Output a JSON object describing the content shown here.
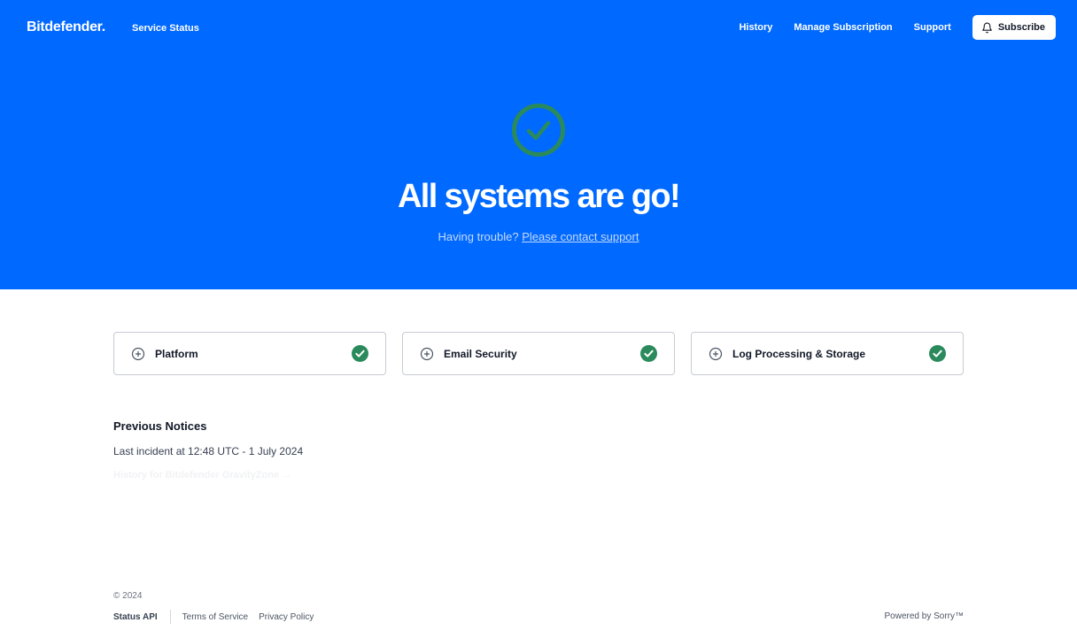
{
  "header": {
    "logo": "Bitdefender.",
    "service_status": "Service Status",
    "nav": {
      "history": "History",
      "manage_subscription": "Manage Subscription",
      "support": "Support",
      "subscribe": "Subscribe"
    }
  },
  "hero": {
    "headline": "All systems are go!",
    "trouble_text": "Having trouble?",
    "support_link": "Please contact support"
  },
  "services": [
    {
      "name": "Platform",
      "status": "operational"
    },
    {
      "name": "Email Security",
      "status": "operational"
    },
    {
      "name": "Log Processing & Storage",
      "status": "operational"
    }
  ],
  "notices": {
    "title": "Previous Notices",
    "last_incident": "Last incident at 12:48 UTC - 1 July 2024",
    "history_link": "History for Bitdefender GravityZone →"
  },
  "footer": {
    "copyright": "© 2024",
    "status_api": "Status API",
    "terms": "Terms of Service",
    "privacy": "Privacy Policy",
    "powered_by": "Powered by Sorry™"
  },
  "colors": {
    "brand_blue": "#0069ff",
    "status_green": "#2a8a5c",
    "card_border": "#c7cbd1"
  },
  "icons": {
    "hero_status": "check-circle-icon",
    "subscribe": "bell-icon",
    "expand": "plus-circle-icon",
    "operational": "check-badge-icon"
  }
}
